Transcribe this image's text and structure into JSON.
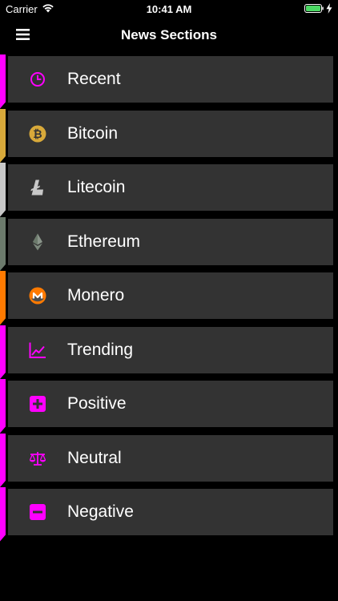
{
  "status": {
    "carrier": "Carrier",
    "time": "10:41 AM"
  },
  "nav": {
    "title": "News Sections"
  },
  "colors": {
    "accent": "#ff00ff",
    "bitcoin": "#d8a93a",
    "litecoin": "#c8c8c8",
    "ethereum": "#6c7a6c",
    "monero": "#ff7a00",
    "card": "#333333"
  },
  "sections": [
    {
      "label": "Recent",
      "icon": "clock-icon",
      "color": "#ff00ff"
    },
    {
      "label": "Bitcoin",
      "icon": "bitcoin-icon",
      "color": "#d8a93a"
    },
    {
      "label": "Litecoin",
      "icon": "litecoin-icon",
      "color": "#c8c8c8"
    },
    {
      "label": "Ethereum",
      "icon": "ethereum-icon",
      "color": "#6c7a6c"
    },
    {
      "label": "Monero",
      "icon": "monero-icon",
      "color": "#ff7a00"
    },
    {
      "label": "Trending",
      "icon": "trending-chart-icon",
      "color": "#ff00ff"
    },
    {
      "label": "Positive",
      "icon": "plus-square-icon",
      "color": "#ff00ff"
    },
    {
      "label": "Neutral",
      "icon": "scale-icon",
      "color": "#ff00ff"
    },
    {
      "label": "Negative",
      "icon": "minus-square-icon",
      "color": "#ff00ff"
    }
  ]
}
